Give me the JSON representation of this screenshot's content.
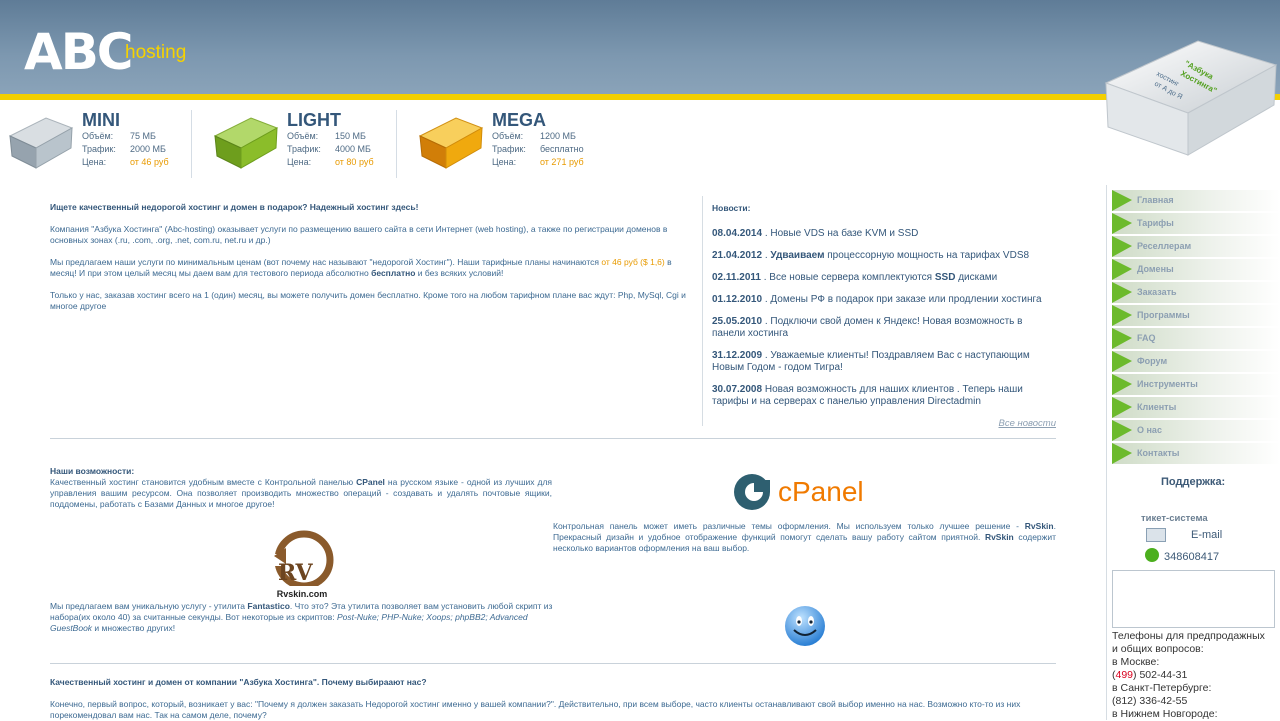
{
  "logo": {
    "abc": "ABC",
    "hosting": "hosting"
  },
  "book_badge": {
    "line1": "\"Азбука",
    "line2": "Хостинга\"",
    "line3": "хостинг",
    "line4": "от А до Я"
  },
  "plans": [
    {
      "name": "MINI",
      "l1": "Объём:",
      "v1": "75 МБ",
      "l2": "Трафик:",
      "v2": "2000 МБ",
      "l3": "Цена:",
      "v3": "от 46 руб",
      "color": "#b9c4cc"
    },
    {
      "name": "LIGHT",
      "l1": "Объём:",
      "v1": "150 МБ",
      "l2": "Трафик:",
      "v2": "4000 МБ",
      "l3": "Цена:",
      "v3": "от 80 руб",
      "color": "#8bbd2a"
    },
    {
      "name": "MEGA",
      "l1": "Объём:",
      "v1": "1200 МБ",
      "l2": "Трафик:",
      "v2": "бесплатно",
      "l3": "Цена:",
      "v3": "от 271 руб",
      "color": "#f0a90e"
    }
  ],
  "intro": {
    "heading": "Ищете качественный недорогой хостинг и домен в подарок? Надежный хостинг здесь!",
    "p1": "Компания \"Азбука Хостинга\" (Abc-hosting) оказывает услуги по размещению вашего сайта в сети Интернет (web hosting), а также по регистрации доменов в основных зонах (.ru, .com, .org, .net, com.ru, net.ru и др.)",
    "p2a": "Мы предлагаем наши услуги по минимальным ценам (вот почему нас называют \"недорогой Хостинг\"). Наши тарифные планы начинаются ",
    "p2price": "от 46 руб ($ 1,6)",
    "p2b": " в месяц! И при этом целый месяц мы даем вам для тестового периода абсолютно ",
    "p2free": "бесплатно",
    "p2c": " и без всяких условий!",
    "p3": "Только у нас, заказав хостинг всего на 1 (один) месяц, вы можете получить домен бесплатно. Кроме того на любом тарифном плане вас ждут: Php, MySql, Cgi и многое другое"
  },
  "news": {
    "title": "Новости:",
    "items": [
      {
        "date": "08.04.2014",
        "pre": " . Новые VDS на базе KVM и SSD",
        "bold": "",
        "post": ""
      },
      {
        "date": "21.04.2012",
        "pre": " . ",
        "bold": "Удваиваем",
        "post": " процессорную мощность на тарифах VDS8"
      },
      {
        "date": "02.11.2011",
        "pre": " . Все новые сервера комплектуются ",
        "bold": "SSD",
        "post": " дисками"
      },
      {
        "date": "01.12.2010",
        "pre": " . Домены РФ в подарок при заказе или продлении хостинга",
        "bold": "",
        "post": ""
      },
      {
        "date": "25.05.2010",
        "pre": " . Подключи свой домен к Яндекс! Новая возможность в панели хостинга",
        "bold": "",
        "post": ""
      },
      {
        "date": "31.12.2009",
        "pre": " . Уважаемые клиенты! Поздравляем Вас с наступающим Новым Годом - годом Тигра!",
        "bold": "",
        "post": ""
      },
      {
        "date": "30.07.2008",
        "pre": " Новая возможность для наших клиентов . Теперь наши тарифы и на серверах с панелью управления Directadmin",
        "bold": "",
        "post": ""
      }
    ],
    "all": "Все новости"
  },
  "features": {
    "heading": "Наши возможности:",
    "p1a": "Качественный хостинг становится удобным вместе с Контрольной панелью ",
    "p1b": "CPanel",
    "p1c": " на русском языке - одной из лучших для управления вашим ресурсом. Она позволяет производить множество операций - создавать и удалять почтовые ящики, поддомены, работать с Базами Данных и многое другое!",
    "cpanel": "cPanel",
    "p2a": "Контрольная панель может иметь различные темы оформления. Мы используем только лучшее решение - ",
    "p2b": "RvSkin",
    "p2c": ". Прекрасный дизайн и удобное отображение функций помогут сделать вашу работу сайтом приятной. ",
    "p2d": "RvSkin",
    "p2e": " содержит несколько вариантов оформления на ваш выбор.",
    "rv": "RV",
    "rvsite": "Rvskin.com",
    "p3a": "Мы предлагаем вам уникальную услугу - утилита ",
    "p3b": "Fantastico",
    "p3c": ". Что это? Эта утилита позволяет вам установить любой скрипт из набора(их около 40)  за считанные секунды. Вот некоторые из скриптов: ",
    "p3d": "Post-Nuke; PHP-Nuke; Xoops; phpBB2; Advanced GuestBook",
    "p3e": " и множество других!"
  },
  "why": {
    "heading": "Качественный хостинг и домен от компании \"Азбука Хостинга\". Почему выбираают нас?",
    "p1": "Конечно, первый вопрос, который, возникает у вас: \"Почему я должен заказать Недорогой хостинг именно у вашей компании?\". Действительно, при всем выборе, часто клиенты останавливают свой выбор именно на нас. Возможно кто-то из них порекомендовал вам нас. Так на самом деле, почему?"
  },
  "menu": [
    "Главная",
    "Тарифы",
    "Реселлерам",
    "Домены",
    "Заказать",
    "Программы",
    "FAQ",
    "Форум",
    "Инструменты",
    "Клиенты",
    "О нас",
    "Контакты"
  ],
  "support": {
    "title": "Поддержка:",
    "ticket": "тикет-система",
    "email": "E-mail",
    "icq": "348608417",
    "phones_title": " Телефоны для предпродажных и общих вопросов:",
    "moscow": "в Москве:",
    "moscow_code": "499",
    "moscow_num": " 502-44-31",
    "spb": " в Санкт-Петербурге:",
    "spb_num": "(812) 336-42-55",
    "nn": "в Нижнем Новгороде:"
  }
}
